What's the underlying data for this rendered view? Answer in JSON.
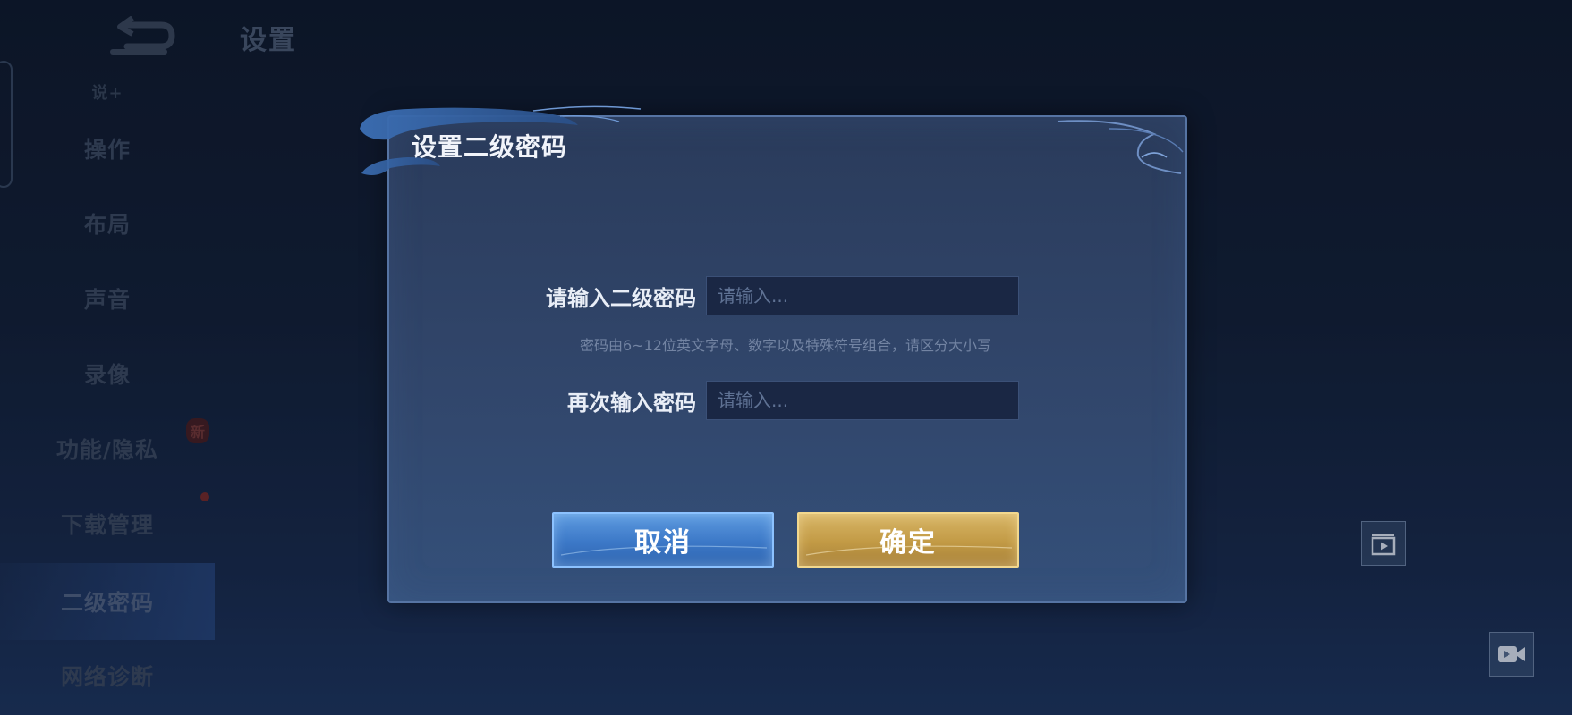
{
  "page": {
    "title": "设置"
  },
  "sidebar": {
    "cut_item": "说+",
    "items": [
      {
        "label": "操作"
      },
      {
        "label": "布局"
      },
      {
        "label": "声音"
      },
      {
        "label": "录像"
      },
      {
        "label": "功能/隐私"
      },
      {
        "label": "下载管理"
      },
      {
        "label": "二级密码"
      },
      {
        "label": "网络诊断"
      }
    ],
    "active_item": "二级密码",
    "new_badge": "新"
  },
  "dialog": {
    "title": "设置二级密码",
    "password_label": "请输入二级密码",
    "password_placeholder": "请输入...",
    "hint": "密码由6~12位英文字母、数字以及特殊符号组合，请区分大小写",
    "confirm_label": "再次输入密码",
    "confirm_placeholder": "请输入...",
    "cancel_button": "取消",
    "ok_button": "确定"
  },
  "icons": {
    "back": "back-arrow-icon",
    "playlist": "playlist-play-icon",
    "video": "video-camera-icon"
  },
  "colors": {
    "cancel_button": "#3c78c7",
    "ok_button": "#c29a45",
    "dialog_bg": "#31466b"
  }
}
